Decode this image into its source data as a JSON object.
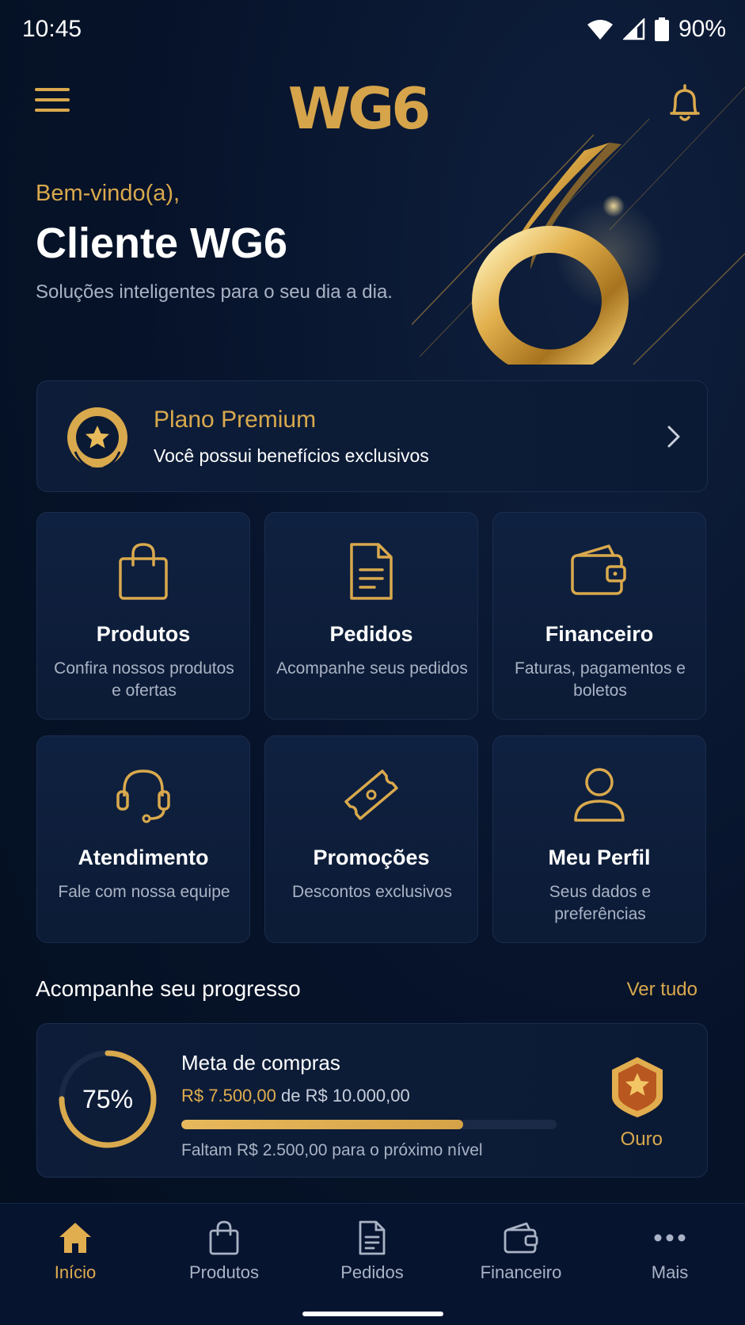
{
  "status_bar": {
    "time": "10:45",
    "battery": "90%"
  },
  "header": {
    "logo": "WG6"
  },
  "hero": {
    "welcome": "Bem-vindo(a),",
    "client_name": "Cliente WG6",
    "tagline": "Soluções inteligentes para o seu dia a dia."
  },
  "premium": {
    "title": "Plano Premium",
    "subtitle": "Você possui benefícios exclusivos"
  },
  "tiles": [
    {
      "title": "Produtos",
      "desc": "Confira nossos produtos e ofertas",
      "icon": "shopping-bag-icon"
    },
    {
      "title": "Pedidos",
      "desc": "Acompanhe seus pedidos",
      "icon": "document-icon"
    },
    {
      "title": "Financeiro",
      "desc": "Faturas, pagamentos e boletos",
      "icon": "wallet-icon"
    },
    {
      "title": "Atendimento",
      "desc": "Fale com nossa equipe",
      "icon": "headset-icon"
    },
    {
      "title": "Promoções",
      "desc": "Descontos exclusivos",
      "icon": "ticket-icon"
    },
    {
      "title": "Meu Perfil",
      "desc": "Seus dados e preferências",
      "icon": "user-icon"
    }
  ],
  "progress": {
    "section_title": "Acompanhe seu progresso",
    "see_all": "Ver tudo",
    "percent_label": "75%",
    "percent_value": 0.75,
    "goal_title": "Meta de compras",
    "current": "R$ 7.500,00",
    "separator": " de ",
    "target": "R$ 10.000,00",
    "remaining": "Faltam R$ 2.500,00 para o próximo nível",
    "tier": "Ouro"
  },
  "bottom_nav": [
    {
      "label": "Início",
      "icon": "home-icon",
      "active": true
    },
    {
      "label": "Produtos",
      "icon": "shopping-bag-icon",
      "active": false
    },
    {
      "label": "Pedidos",
      "icon": "document-icon",
      "active": false
    },
    {
      "label": "Financeiro",
      "icon": "wallet-icon",
      "active": false
    },
    {
      "label": "Mais",
      "icon": "more-icon",
      "active": false
    }
  ],
  "colors": {
    "background": "#061229",
    "accent_gold": "#d9a94d",
    "card": "#0d1d39",
    "muted_text": "#aab3c5"
  }
}
